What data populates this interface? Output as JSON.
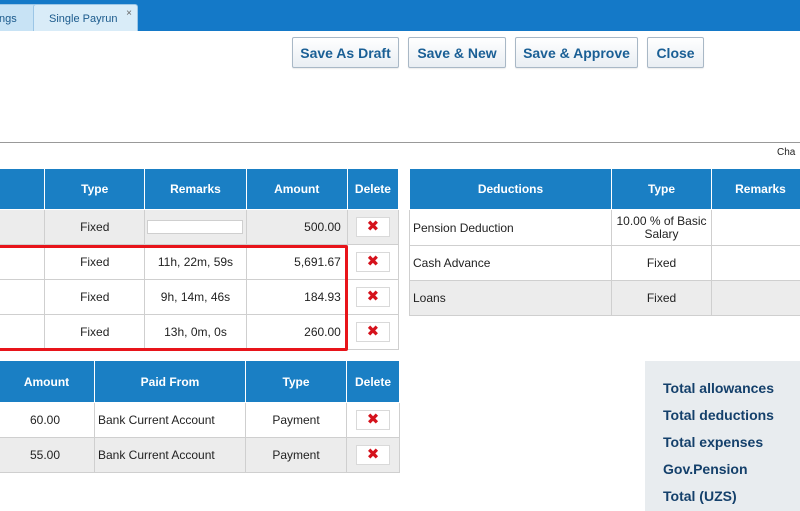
{
  "tabs": {
    "partial_label": "ngs",
    "active_label": "Single Payrun",
    "close_glyph": "×"
  },
  "toolbar": {
    "save_draft": "Save As Draft",
    "save_new": "Save & New",
    "save_approve": "Save & Approve",
    "close": "Close"
  },
  "cha_label": "Cha",
  "allowances": {
    "headers": {
      "type": "Type",
      "remarks": "Remarks",
      "amount": "Amount",
      "delete": "Delete"
    },
    "rows": [
      {
        "type": "Fixed",
        "remarks": "",
        "amount": "500.00"
      },
      {
        "type": "Fixed",
        "remarks": "11h, 22m, 59s",
        "amount": "5,691.67"
      },
      {
        "type": "Fixed",
        "remarks": "9h, 14m, 46s",
        "amount": "184.93"
      },
      {
        "type": "Fixed",
        "remarks": "13h, 0m, 0s",
        "amount": "260.00"
      }
    ]
  },
  "deductions": {
    "headers": {
      "name": "Deductions",
      "type": "Type",
      "remarks": "Remarks"
    },
    "rows": [
      {
        "name": "Pension Deduction",
        "type_line1": "10.00 % of Basic",
        "type_line2": "Salary",
        "remarks": ""
      },
      {
        "name": "Cash Advance",
        "type": "Fixed",
        "remarks": ""
      },
      {
        "name": "Loans",
        "type": "Fixed",
        "remarks": ""
      }
    ]
  },
  "expenses": {
    "headers": {
      "amount": "Amount",
      "paid_from": "Paid From",
      "type": "Type",
      "delete": "Delete"
    },
    "rows": [
      {
        "amount": "60.00",
        "paid_from": "Bank Current Account",
        "type": "Payment"
      },
      {
        "amount": "55.00",
        "paid_from": "Bank Current Account",
        "type": "Payment"
      }
    ]
  },
  "totals": {
    "allowances": "Total allowances",
    "deductions": "Total deductions",
    "expenses": "Total expenses",
    "pension": "Gov.Pension",
    "total": "Total (UZS)"
  },
  "icons": {
    "delete": "✖"
  },
  "colors": {
    "header_blue": "#1a7fc4",
    "tab_bar": "#1479c8",
    "highlight": "#e8141a",
    "delete_red": "#d5121c",
    "totals_text": "#14406b"
  }
}
